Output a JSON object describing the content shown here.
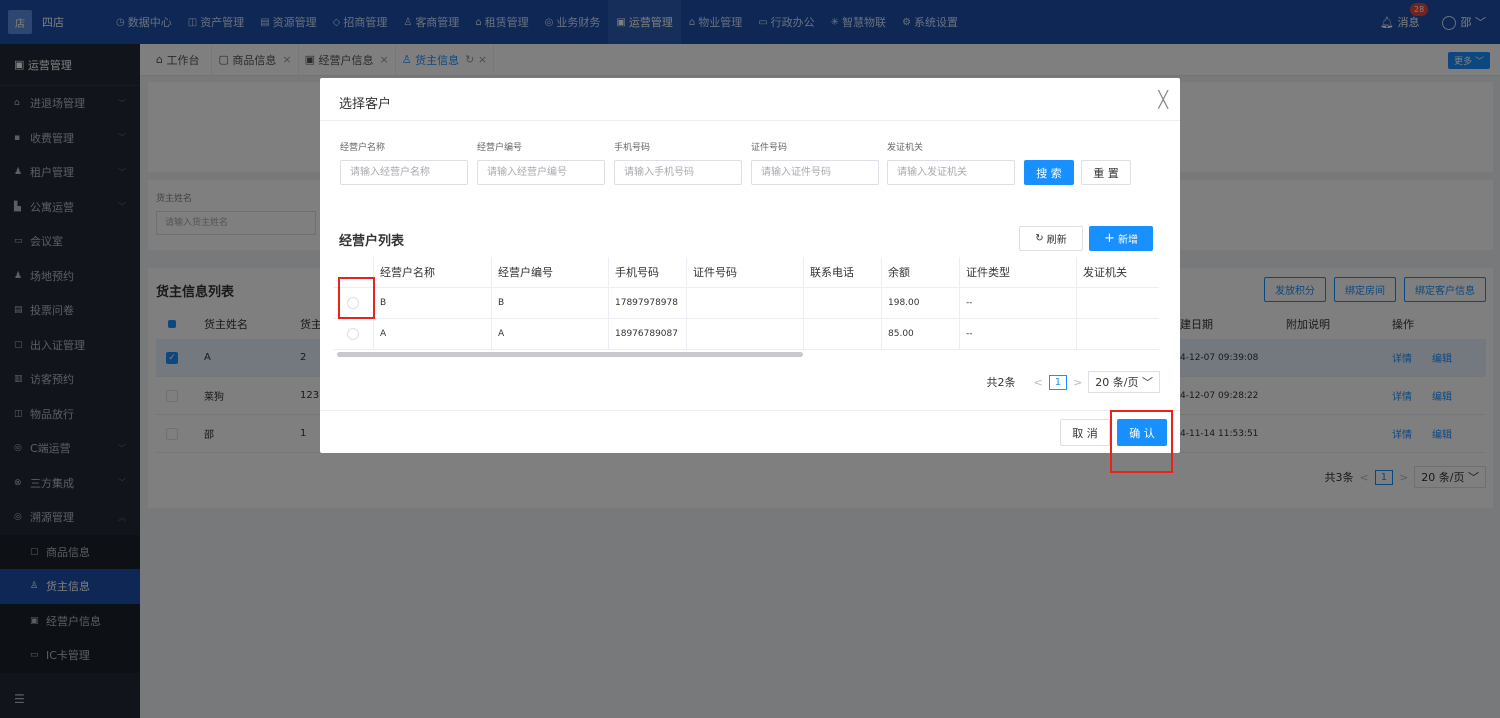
{
  "app": {
    "brand": "四店",
    "logo_text": "店"
  },
  "nav": [
    {
      "icon": "dashboard-icon",
      "glyph": "◷",
      "label": "数据中心"
    },
    {
      "icon": "cube-icon",
      "glyph": "◫",
      "label": "资产管理"
    },
    {
      "icon": "resource-icon",
      "glyph": "▤",
      "label": "资源管理"
    },
    {
      "icon": "tag-icon",
      "glyph": "◇",
      "label": "招商管理"
    },
    {
      "icon": "users-icon",
      "glyph": "♙",
      "label": "客商管理"
    },
    {
      "icon": "home-icon",
      "glyph": "⌂",
      "label": "租赁管理"
    },
    {
      "icon": "finance-icon",
      "glyph": "◎",
      "label": "业务财务"
    },
    {
      "icon": "operation-icon",
      "glyph": "▣",
      "label": "运营管理"
    },
    {
      "icon": "building-icon",
      "glyph": "⌂",
      "label": "物业管理"
    },
    {
      "icon": "office-icon",
      "glyph": "▭",
      "label": "行政办公"
    },
    {
      "icon": "iot-icon",
      "glyph": "✳",
      "label": "智慧物联"
    },
    {
      "icon": "settings-icon",
      "glyph": "⚙",
      "label": "系统设置"
    }
  ],
  "top_right": {
    "messages_label": "消息",
    "messages_count": "28",
    "user_label": "邵"
  },
  "sidebar": {
    "header": "运营管理",
    "items": [
      {
        "label": "进退场管理",
        "glyph": "⌂",
        "chevron": "﹀"
      },
      {
        "label": "收费管理",
        "glyph": "▪",
        "chevron": "﹀"
      },
      {
        "label": "租户管理",
        "glyph": "♟",
        "chevron": "﹀"
      },
      {
        "label": "公寓运营",
        "glyph": "▙",
        "chevron": "﹀"
      },
      {
        "label": "会议室",
        "glyph": "▭",
        "chevron": ""
      },
      {
        "label": "场地预约",
        "glyph": "♟",
        "chevron": ""
      },
      {
        "label": "投票问卷",
        "glyph": "▤",
        "chevron": ""
      },
      {
        "label": "出入证管理",
        "glyph": "▢",
        "chevron": ""
      },
      {
        "label": "访客预约",
        "glyph": "▥",
        "chevron": ""
      },
      {
        "label": "物品放行",
        "glyph": "◫",
        "chevron": ""
      },
      {
        "label": "C端运营",
        "glyph": "◎",
        "chevron": "﹀"
      },
      {
        "label": "三方集成",
        "glyph": "⊗",
        "chevron": "﹀"
      },
      {
        "label": "溯源管理",
        "glyph": "◎",
        "chevron": "︿"
      }
    ],
    "subitems": [
      {
        "label": "商品信息",
        "glyph": "▢"
      },
      {
        "label": "货主信息",
        "glyph": "♙"
      },
      {
        "label": "经营户信息",
        "glyph": "▣"
      },
      {
        "label": "IC卡管理",
        "glyph": "▭"
      }
    ],
    "collapse_glyph": "☰"
  },
  "tabs": [
    {
      "label": "工作台",
      "glyph": "⌂",
      "close": ""
    },
    {
      "label": "商品信息",
      "glyph": "▢",
      "close": "×"
    },
    {
      "label": "经营户信息",
      "glyph": "▣",
      "close": "×"
    },
    {
      "label": "货主信息",
      "glyph": "♙",
      "close": "↻ ×"
    }
  ],
  "more_label": "更多 ﹀",
  "bg_page": {
    "filter_label": "货主姓名",
    "filter_placeholder": "请输入货主姓名",
    "list_title": "货主信息列表",
    "buttons": [
      "发放积分",
      "绑定房间",
      "绑定客户信息"
    ],
    "headers": {
      "name": "货主姓名",
      "num": "货主",
      "date": "建日期",
      "note": "附加说明",
      "op": "操作"
    },
    "rows": [
      {
        "name": "A",
        "num": "2",
        "date": "4-12-07 09:39:08",
        "detail": "详情",
        "edit": "编辑",
        "selected": true
      },
      {
        "name": "莱狗",
        "num": "123",
        "date": "4-12-07 09:28:22",
        "detail": "详情",
        "edit": "编辑",
        "selected": false
      },
      {
        "name": "邵",
        "num": "1",
        "date": "4-11-14 11:53:51",
        "detail": "详情",
        "edit": "编辑",
        "selected": false
      }
    ],
    "pager": {
      "total": "共3条",
      "page": "1",
      "size": "20 条/页 ﹀",
      "prev": "<",
      "next": ">"
    }
  },
  "modal": {
    "title": "选择客户",
    "close_glyph": "╳",
    "filters": [
      {
        "label": "经营户名称",
        "placeholder": "请输入经营户名称"
      },
      {
        "label": "经营户编号",
        "placeholder": "请输入经营户编号"
      },
      {
        "label": "手机号码",
        "placeholder": "请输入手机号码"
      },
      {
        "label": "证件号码",
        "placeholder": "请输入证件号码"
      },
      {
        "label": "发证机关",
        "placeholder": "请输入发证机关"
      }
    ],
    "search_label": "搜 索",
    "reset_label": "重 置",
    "list_title": "经营户列表",
    "refresh_label": "刷新",
    "refresh_glyph": "↻",
    "add_label": "新增",
    "add_glyph": "+",
    "columns": [
      "经营户名称",
      "经营户编号",
      "手机号码",
      "证件号码",
      "联系电话",
      "余额",
      "证件类型",
      "发证机关"
    ],
    "rows": [
      {
        "name": "B",
        "code": "B",
        "phone": "17897978978",
        "id": "",
        "contact": "",
        "balance": "198.00",
        "id_type": "--",
        "issuer": ""
      },
      {
        "name": "A",
        "code": "A",
        "phone": "18976789087",
        "id": "",
        "contact": "",
        "balance": "85.00",
        "id_type": "--",
        "issuer": ""
      }
    ],
    "pager": {
      "total": "共2条",
      "page": "1",
      "size": "20 条/页 ﹀",
      "prev": "<",
      "next": ">"
    },
    "cancel_label": "取 消",
    "confirm_label": "确 认"
  }
}
